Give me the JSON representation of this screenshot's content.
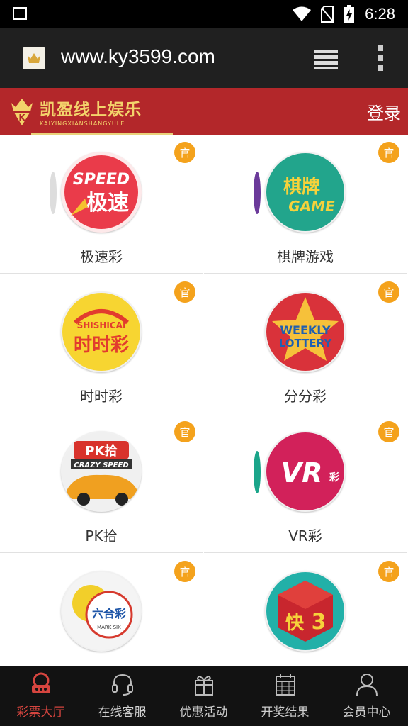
{
  "status_bar": {
    "time": "6:28"
  },
  "browser": {
    "url": "www.ky3599.com"
  },
  "header": {
    "brand_cn": "凯盈线上娱乐",
    "brand_en": "KAIYINGXIANSHANGYULE",
    "login_label": "登录"
  },
  "games": [
    {
      "label": "极速彩",
      "badge": "官",
      "logo_text_1": "SPEED",
      "logo_text_2": "极速"
    },
    {
      "label": "棋牌游戏",
      "badge": "官",
      "logo_text_1": "棋牌",
      "logo_text_2": "GAME"
    },
    {
      "label": "时时彩",
      "badge": "官",
      "logo_text_1": "SHISHICAI",
      "logo_text_2": "时时彩"
    },
    {
      "label": "分分彩",
      "badge": "官",
      "logo_text_1": "WEEKLY",
      "logo_text_2": "LOTTERY"
    },
    {
      "label": "PK拾",
      "badge": "官",
      "logo_text_1": "PK拾",
      "logo_text_2": "CRAZY SPEED"
    },
    {
      "label": "VR彩",
      "badge": "官",
      "logo_text_1": "VR",
      "logo_text_2": "彩"
    },
    {
      "label": "",
      "badge": "官",
      "logo_text_1": "六合彩",
      "logo_text_2": "MARK SIX"
    },
    {
      "label": "",
      "badge": "官",
      "logo_text_1": "快",
      "logo_text_2": "3"
    }
  ],
  "tabbar": [
    {
      "label": "彩票大厅",
      "icon": "lottery-hall-icon",
      "active": true
    },
    {
      "label": "在线客服",
      "icon": "headset-icon"
    },
    {
      "label": "优惠活动",
      "icon": "gift-icon"
    },
    {
      "label": "开奖结果",
      "icon": "calendar-icon"
    },
    {
      "label": "会员中心",
      "icon": "user-icon"
    }
  ],
  "colors": {
    "header_red": "#b3272a",
    "badge_orange": "#f4a21c",
    "active_tab": "#d6453f"
  }
}
